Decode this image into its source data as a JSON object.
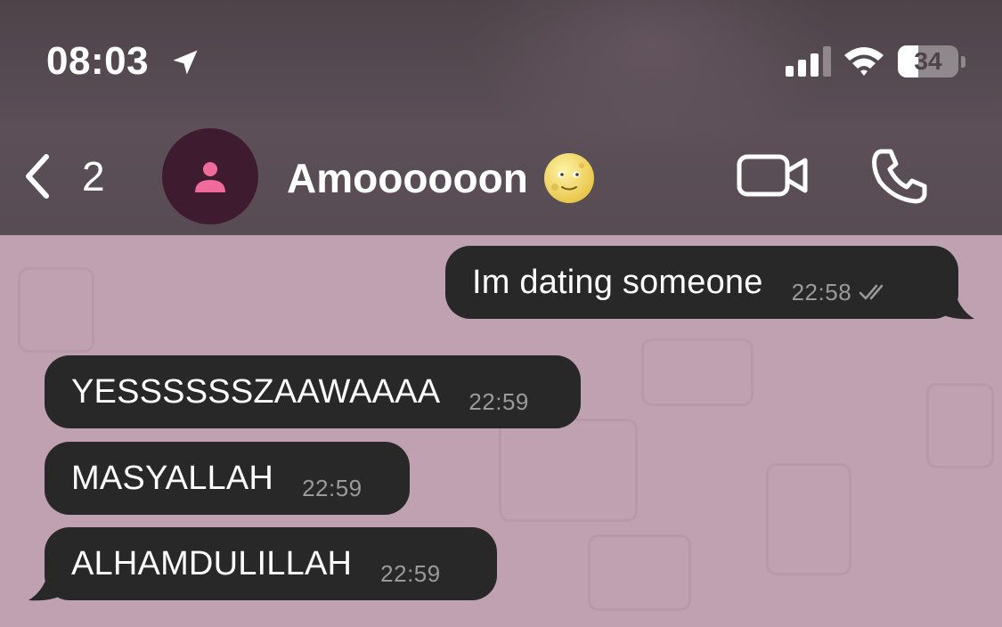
{
  "status_bar": {
    "time": "08:03",
    "battery_level": "34"
  },
  "header": {
    "back_count": "2",
    "contact_name": "Amoooooon"
  },
  "messages": [
    {
      "direction": "outgoing",
      "text": "Im dating someone",
      "time": "22:58",
      "read": true
    },
    {
      "direction": "incoming",
      "text": "YESSSSSSZAAWAAAA",
      "time": "22:59"
    },
    {
      "direction": "incoming",
      "text": "MASYALLAH",
      "time": "22:59"
    },
    {
      "direction": "incoming",
      "text": "ALHAMDULILLAH",
      "time": "22:59"
    }
  ],
  "colors": {
    "header_background": "#4d4349",
    "chat_background": "#c0a1b2",
    "bubble_background": "#282828",
    "avatar_background": "#3e1b2e",
    "avatar_accent": "#f06a9b"
  },
  "icons": [
    "location-arrow-icon",
    "signal-icon",
    "wifi-icon",
    "battery-icon",
    "chevron-left-icon",
    "person-icon",
    "full-moon-face-emoji",
    "video-camera-icon",
    "phone-icon",
    "double-check-icon"
  ]
}
